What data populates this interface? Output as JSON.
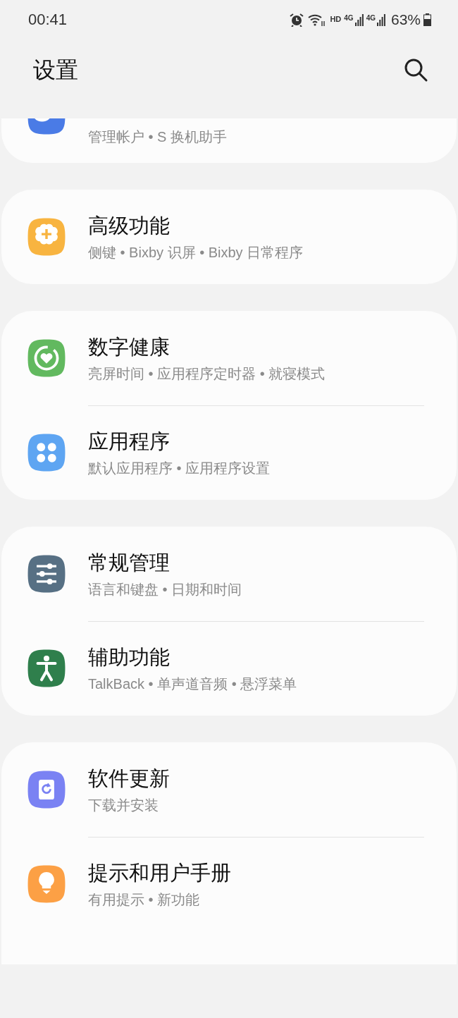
{
  "status_bar": {
    "time": "00:41",
    "network_labels": [
      "HD",
      "4G",
      "4G"
    ],
    "battery": "63%"
  },
  "header": {
    "title": "设置"
  },
  "groups": [
    {
      "items": [
        {
          "subtitle": "管理帐户 • S 换机助手",
          "color": "#4a7be6",
          "kind": "partial"
        }
      ]
    },
    {
      "items": [
        {
          "title": "高级功能",
          "subtitle": "侧键 • Bixby 识屏 • Bixby 日常程序",
          "color": "#f8b440",
          "kind": "full"
        }
      ]
    },
    {
      "items": [
        {
          "title": "数字健康",
          "subtitle": "亮屏时间 • 应用程序定时器 • 就寝模式",
          "color": "#62b95f",
          "kind": "full"
        },
        {
          "title": "应用程序",
          "subtitle": "默认应用程序 • 应用程序设置",
          "color": "#5ea5f2",
          "kind": "full"
        }
      ]
    },
    {
      "items": [
        {
          "title": "常规管理",
          "subtitle": "语言和键盘 • 日期和时间",
          "color": "#577084",
          "kind": "full"
        },
        {
          "title": "辅助功能",
          "subtitle": "TalkBack • 单声道音频 • 悬浮菜单",
          "color": "#2f7f4c",
          "kind": "full"
        }
      ]
    },
    {
      "items": [
        {
          "title": "软件更新",
          "subtitle": "下载并安装",
          "color": "#7a82f3",
          "kind": "full"
        },
        {
          "title": "提示和用户手册",
          "subtitle": "有用提示 • 新功能",
          "color": "#fca045",
          "kind": "full"
        }
      ]
    }
  ]
}
